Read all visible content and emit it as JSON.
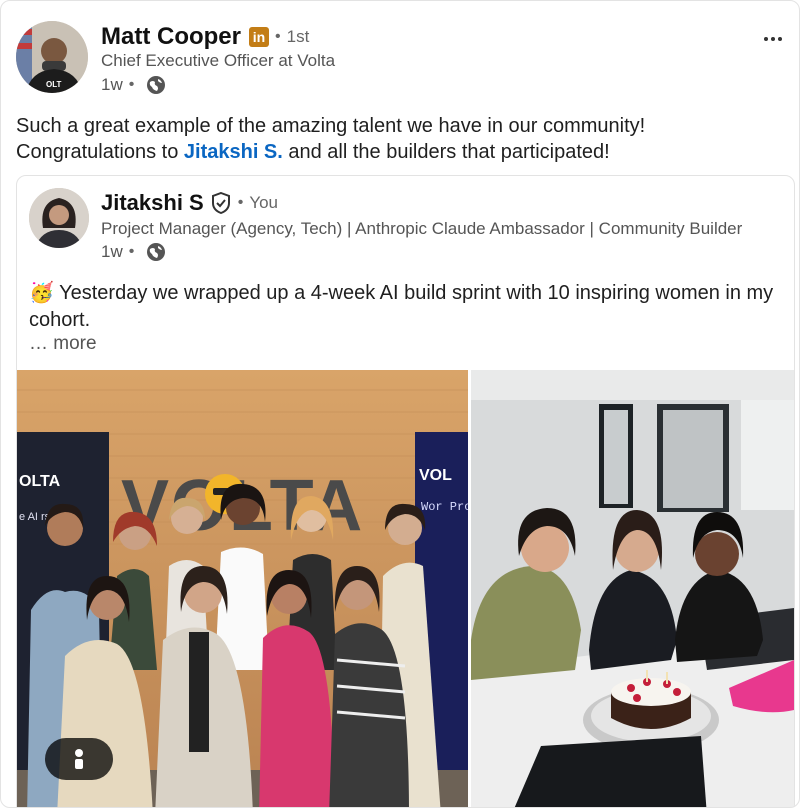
{
  "post": {
    "author": {
      "name": "Matt Cooper",
      "badge": "in",
      "degree": "1st",
      "headline": "Chief Executive Officer at Volta",
      "time": "1w",
      "visibility_icon": "globe-icon"
    },
    "more_icon": "more-horizontal-icon",
    "text_line1": "Such a great example of the amazing talent we have in our community!",
    "text_line2_before": "Congratulations to ",
    "mention": "Jitakshi S.",
    "text_line2_after": " and all the builders that participated!"
  },
  "shared_post": {
    "author": {
      "name": "Jitakshi S",
      "verified_icon": "verified-shield-icon",
      "relation": "You",
      "headline": "Project Manager (Agency, Tech) | Anthropic Claude Ambassador | Community Builder",
      "time": "1w",
      "visibility_icon": "globe-icon"
    },
    "emoji": "🥳",
    "text": " Yesterday we wrapped up a 4-week AI build sprint with 10 inspiring women in my cohort.",
    "see_more": "… more",
    "photo_left_sign": "VOLTA",
    "photo_left_banner_left": "OLTA",
    "photo_left_banner_left_text": "e AI   rs, rtup",
    "photo_left_banner_right": "VOL",
    "photo_left_banner_right_text": "Wor Prob Drive anac",
    "image_badge_icon": "person-tag-icon"
  },
  "colors": {
    "link": "#0a66c2",
    "badge": "#c37d16",
    "text_secondary": "#555555"
  }
}
